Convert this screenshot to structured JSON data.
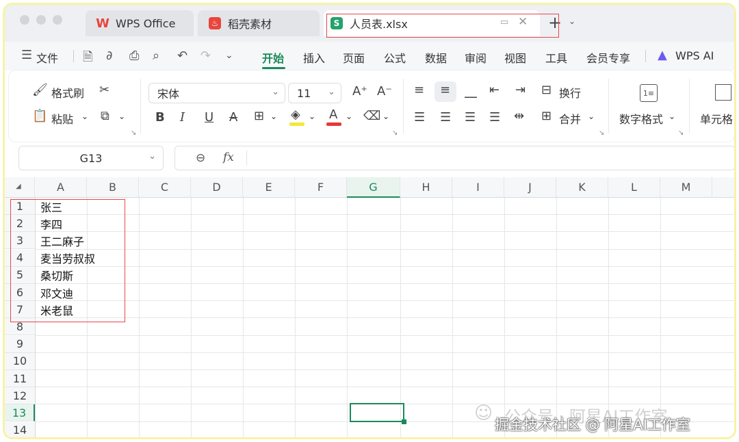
{
  "tabs": [
    {
      "label": "WPS Office",
      "icon": "wps-logo-icon"
    },
    {
      "label": "稻壳素材",
      "icon": "docer-logo-icon"
    },
    {
      "label": "人员表.xlsx",
      "icon": "spreadsheet-logo-icon",
      "active": true
    }
  ],
  "menu": {
    "file_label": "文件",
    "items": [
      "开始",
      "插入",
      "页面",
      "公式",
      "数据",
      "审阅",
      "视图",
      "工具",
      "会员专享"
    ],
    "active": "开始",
    "ai_label": "WPS AI"
  },
  "ribbon": {
    "format_painter": "格式刷",
    "paste": "粘贴",
    "font_name": "宋体",
    "font_size": "11",
    "wrap_text": "换行",
    "merge": "合并",
    "number_format": "数字格式",
    "cell": "单元格"
  },
  "formula_bar": {
    "cell_ref": "G13",
    "fx": "fx",
    "content": ""
  },
  "sheet": {
    "columns": [
      "A",
      "B",
      "C",
      "D",
      "E",
      "F",
      "G",
      "H",
      "I",
      "J",
      "K",
      "L",
      "M"
    ],
    "selected_column": "G",
    "rows": [
      "1",
      "2",
      "3",
      "4",
      "5",
      "6",
      "7",
      "8",
      "9",
      "10",
      "11",
      "12",
      "13",
      "14"
    ],
    "selected_row": "13",
    "column_a_values": [
      "张三",
      "李四",
      "王二麻子",
      "麦当劳叔叔",
      "桑切斯",
      "邓文迪",
      "米老鼠"
    ]
  },
  "watermark": {
    "line1": "公众号 · 阿星AI工作室",
    "line2": "掘金技术社区 @ 阿星AI工作室"
  },
  "colors": {
    "accent": "#1a8a5a",
    "highlight_box": "#e6474a",
    "frame_border": "#f8f3a6",
    "wps_red": "#e8453c",
    "sheet_green": "#23a36b"
  }
}
